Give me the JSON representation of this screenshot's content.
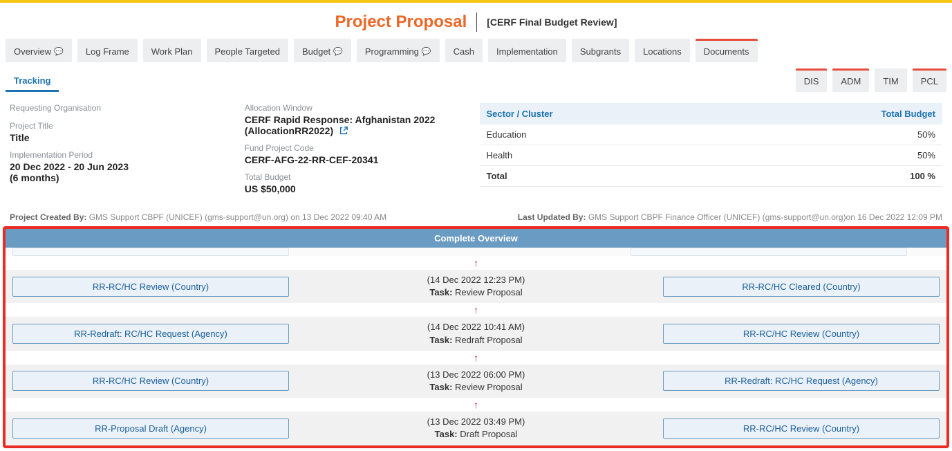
{
  "header": {
    "title": "Project Proposal",
    "subtitle": "[CERF Final Budget Review]"
  },
  "tabs": {
    "left": [
      {
        "label": "Overview",
        "comment": true
      },
      {
        "label": "Log Frame"
      },
      {
        "label": "Work Plan"
      },
      {
        "label": "People Targeted"
      },
      {
        "label": "Budget",
        "comment": true
      },
      {
        "label": "Programming",
        "comment": true
      },
      {
        "label": "Cash"
      },
      {
        "label": "Implementation"
      },
      {
        "label": "Subgrants"
      },
      {
        "label": "Locations"
      },
      {
        "label": "Documents",
        "red": true
      },
      {
        "label": "Tracking",
        "active": true
      }
    ],
    "right": [
      {
        "label": "DIS",
        "red": true
      },
      {
        "label": "ADM",
        "red": true
      },
      {
        "label": "TIM"
      },
      {
        "label": "PCL",
        "red": true
      }
    ]
  },
  "info_left": {
    "org_label": "Requesting Organisation",
    "org_value": "",
    "title_label": "Project Title",
    "title_value": "Title",
    "period_label": "Implementation Period",
    "period_value_1": "20 Dec 2022 - 20 Jun 2023",
    "period_value_2": "(6 months)"
  },
  "info_mid": {
    "window_label": "Allocation Window",
    "window_value": "CERF Rapid Response: Afghanistan 2022 (AllocationRR2022)",
    "code_label": "Fund Project Code",
    "code_value": "CERF-AFG-22-RR-CEF-20341",
    "budget_label": "Total Budget",
    "budget_value": "US $50,000"
  },
  "sector": {
    "header_left": "Sector / Cluster",
    "header_right": "Total Budget",
    "rows": [
      {
        "name": "Education",
        "value": "50%"
      },
      {
        "name": "Health",
        "value": "50%"
      }
    ],
    "total_label": "Total",
    "total_value": "100 %"
  },
  "meta": {
    "created_label": "Project Created By:",
    "created_value": "GMS Support CBPF (UNICEF) (gms-support@un.org) on 13 Dec 2022 09:40 AM",
    "updated_label": "Last Updated By:",
    "updated_value": "GMS Support CBPF Finance Officer (UNICEF) (gms-support@un.org)on 16 Dec 2022 12:09 PM"
  },
  "overview_header": "Complete Overview",
  "task_label": "Task:",
  "tracking": [
    {
      "left": "RR-RC/HC Review (Country)",
      "date": "(14 Dec 2022 12:23 PM)",
      "task": "Review Proposal",
      "right": "RR-RC/HC Cleared (Country)"
    },
    {
      "left": "RR-Redraft: RC/HC Request (Agency)",
      "date": "(14 Dec 2022 10:41 AM)",
      "task": "Redraft Proposal",
      "right": "RR-RC/HC Review (Country)"
    },
    {
      "left": "RR-RC/HC Review (Country)",
      "date": "(13 Dec 2022 06:00 PM)",
      "task": "Review Proposal",
      "right": "RR-Redraft: RC/HC Request (Agency)"
    },
    {
      "left": "RR-Proposal Draft (Agency)",
      "date": "(13 Dec 2022 03:49 PM)",
      "task": "Draft Proposal",
      "right": "RR-RC/HC Review (Country)"
    }
  ]
}
